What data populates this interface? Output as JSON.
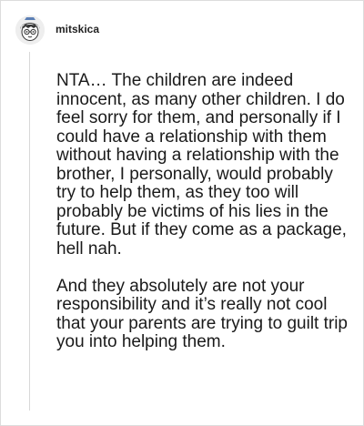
{
  "comment": {
    "username": "mitskica",
    "avatar_icon": "avatar-cartoon-face",
    "paragraphs": [
      "NTA… The children are indeed innocent, as many other children. I do feel sorry for them, and personally if I could have a relationship with them without having a relationship with the brother, I personally, would probably try to help them, as they too will probably be victims of his lies in the future. But if they come as a package, hell nah.",
      "And they absolutely are not your responsibility and it’s really not cool that your parents are trying to guilt trip you into helping them."
    ]
  },
  "colors": {
    "border": "#dcdcdc",
    "thread_line": "#d8d8d8",
    "text": "#1a1a1a"
  }
}
